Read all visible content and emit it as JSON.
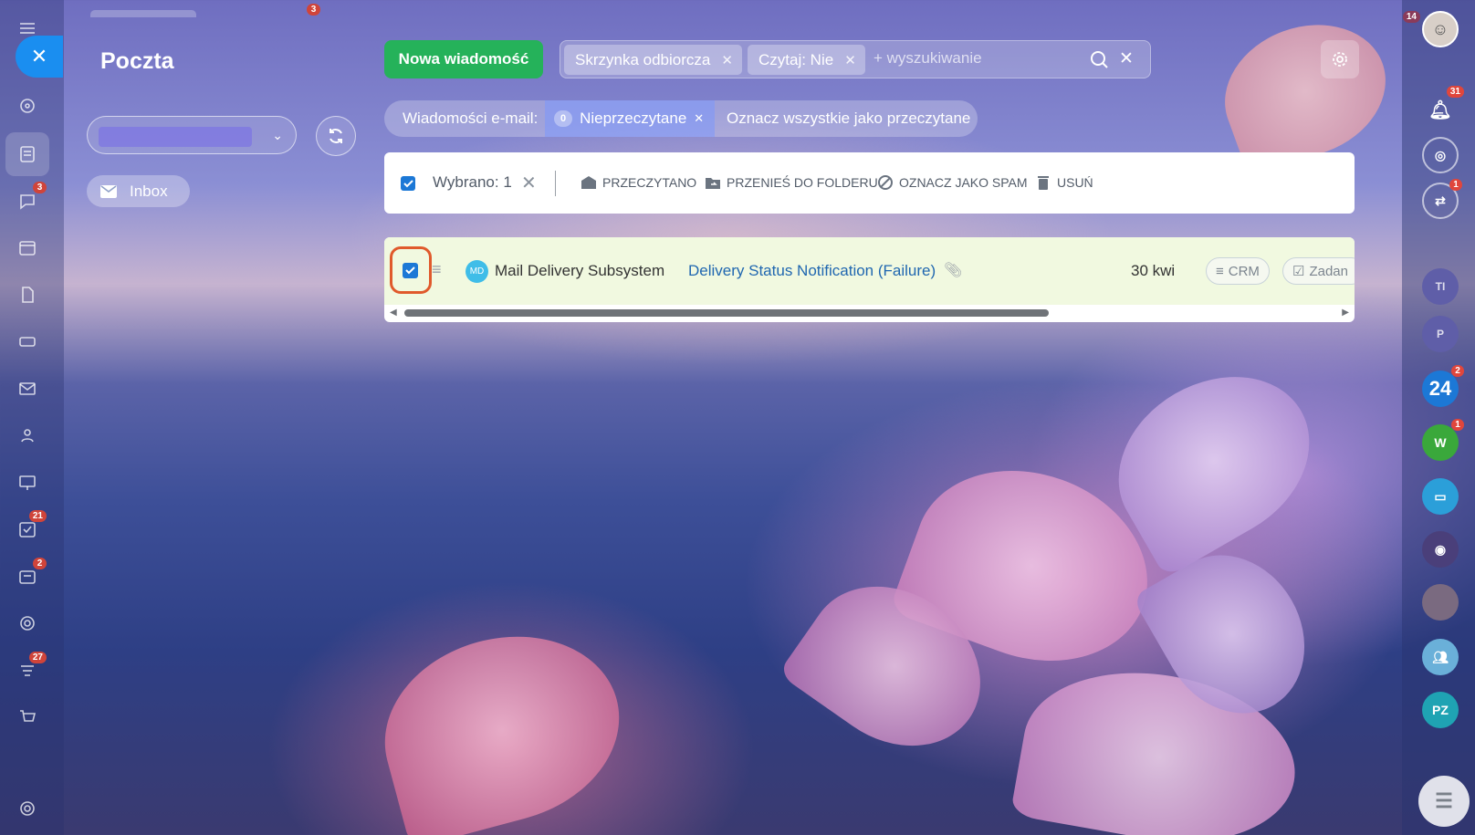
{
  "app": {
    "title": "Poczta"
  },
  "left_nav": {
    "items": [
      {
        "name": "menu-icon",
        "badge": ""
      },
      {
        "name": "ai-icon",
        "badge": ""
      },
      {
        "name": "feed-icon",
        "badge": ""
      },
      {
        "name": "chat-icon",
        "badge": "3"
      },
      {
        "name": "calendar-icon",
        "badge": ""
      },
      {
        "name": "document-icon",
        "badge": ""
      },
      {
        "name": "drive-icon",
        "badge": ""
      },
      {
        "name": "mail-icon",
        "badge": ""
      },
      {
        "name": "contacts-icon",
        "badge": ""
      },
      {
        "name": "presentation-icon",
        "badge": ""
      },
      {
        "name": "tasks-icon",
        "badge": "21"
      },
      {
        "name": "crm-icon",
        "badge": "2"
      },
      {
        "name": "target-icon",
        "badge": ""
      },
      {
        "name": "automation-icon",
        "badge": "27"
      },
      {
        "name": "cart-icon",
        "badge": ""
      },
      {
        "name": "settings-icon",
        "badge": ""
      }
    ],
    "top_badge": "3"
  },
  "sidebar": {
    "mailbox_select_value": "",
    "inbox_label": "Inbox"
  },
  "toolbar": {
    "new_message": "Nowa wiadomość",
    "filters": [
      "Skrzynka odbiorcza",
      "Czytaj: Nie"
    ],
    "search_placeholder": "+ wyszukiwanie"
  },
  "counters": {
    "label": "Wiadomości e-mail:",
    "unread_count": "0",
    "unread_label": "Nieprzeczytane",
    "mark_all": "Oznacz wszystkie jako przeczytane"
  },
  "actions": {
    "selected": "Wybrano: 1",
    "read": "PRZECZYTANO",
    "move": "PRZENIEŚ DO FOLDERU",
    "spam": "OZNACZ JAKO SPAM",
    "delete": "USUŃ"
  },
  "messages": [
    {
      "avatar": "MD",
      "sender": "Mail Delivery Subsystem",
      "subject": "Delivery Status Notification (Failure)",
      "date": "30 kwi",
      "crm": "CRM",
      "task": "Zadan",
      "checked": true
    }
  ],
  "right_bar": {
    "notifications_badge": "31",
    "chat_badge": "1",
    "top_badge": "14",
    "items": [
      {
        "label": "TI",
        "color": "#5f5ea8",
        "badge": ""
      },
      {
        "label": "P",
        "color": "#5f5ea8",
        "badge": ""
      },
      {
        "label": "24",
        "color": "#1c78d6",
        "badge": "2"
      },
      {
        "label": "W",
        "color": "#3aa83b",
        "badge": "1"
      },
      {
        "label": "",
        "color": "#2b9fd9",
        "badge": ""
      },
      {
        "label": "",
        "color": "#4a3f7a",
        "badge": ""
      },
      {
        "label": "",
        "color": "#7a6a80",
        "badge": ""
      },
      {
        "label": "",
        "color": "#6ab0d9",
        "badge": ""
      },
      {
        "label": "PZ",
        "color": "#1fa3b3",
        "badge": ""
      }
    ]
  },
  "colors": {
    "accent": "#1c78d6",
    "primary_button": "#25b25a",
    "highlight": "#e05a2c",
    "row_bg": "#f1f9e0"
  }
}
